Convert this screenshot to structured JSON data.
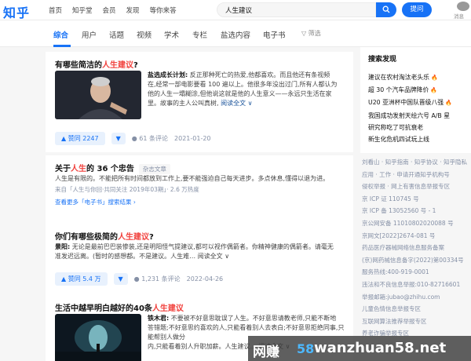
{
  "header": {
    "logo": "知乎",
    "nav": [
      "首页",
      "知乎堂",
      "会员",
      "发现",
      "等你来答"
    ],
    "search_value": "人生建议",
    "ask_label": "提问",
    "avatar_caption": "消息"
  },
  "tabs": {
    "items": [
      "综合",
      "用户",
      "话题",
      "视频",
      "学术",
      "专栏",
      "盐选内容",
      "电子书"
    ],
    "filter": "筛选"
  },
  "results": [
    {
      "title_pre": "有哪些简洁的",
      "title_hl": "人生建议",
      "title_post": "?",
      "author": "盐选成长计划:",
      "lines": [
        "反正那种死亡的热爱,他都喜欢。而且他还有条视频",
        "在,经常一部电影要看 100 遍以上。他很多年没出过门,所有人都认为",
        "他的人生一塌糊涂,但他说这就是他的人生意义——永远只生活在家",
        "里。故事的主人公叫真树,"
      ],
      "read_more": "阅读全文 ∨",
      "vote": "▲ 赞同 2247",
      "down": "▼",
      "comments": "● 61 条评论",
      "date": "2021-01-20"
    },
    {
      "title_pre": "关于",
      "title_hl": "人生",
      "title_post": "的 36 个忠告",
      "tag": "杂志文章",
      "lines": [
        "人生是有限的。不能把所有时间都放到工作上,要不能强迫自己每天进步。多点休息,懂得以退为进。"
      ],
      "source": "来自「人生与你回·共同关注 2019年03期」· 2.6 万热度",
      "ebook_link": "查看更多「电子书」搜索结果 ›"
    },
    {
      "title_pre": "你们有哪些极简的",
      "title_hl": "人生建议",
      "title_post": "?",
      "author": "景阳:",
      "lines": [
        "无论是最前巴巴装惨装,还是明阳怪气提建议,都可以视作偶箭者。你精神健康的偶箭者。请毫无",
        "准发迟远离。(暂时的感想都。不是建议。人生难… 阅读全文 ∨"
      ],
      "vote": "▲ 赞同 5.4 万",
      "down": "▼",
      "comments": "● 1,231 条评论",
      "date": "2022-04-26"
    },
    {
      "title_pre": "生活中越早明白越好的40条",
      "title_hl": "人生建议",
      "title_post": "",
      "author": "铁木君:",
      "lines": [
        "不要被不好意思耽误了人生。不好意思请教老师,只能不断地",
        "答错题;不好意思约喜欢的人,只能看着别人去表白;不好意思拒绝同事,只能帮别人做分",
        "内,只能看着别人升职加薪。人生建议… 阅读全文 ∨"
      ]
    }
  ],
  "sidebar": {
    "title": "搜索发现",
    "hot": [
      "建议在农村淘汰老头乐",
      "超 30 个汽车品牌降价",
      "U20 亚洲杯中国队晋级八强",
      "我国成功发射天绘六号 A/B 星",
      "研究称吃了可抗衰老",
      "新生化危机四试玩上线"
    ],
    "hot_flags": [
      true,
      true,
      true,
      false,
      false,
      false
    ],
    "footer": [
      "刘看山 · 知乎指南 · 知乎协议 · 知乎隐私",
      "应用 · 工作 · 申请开通知乎机构号",
      "侵权举报 · 网上有害信息举报专区",
      "京 ICP 证 110745 号",
      "京 ICP 备 13052560 号 - 1",
      "京公网安备 11010802020088 号",
      "京网文[2022]2674-081 号",
      "药品医疗器械网络信息服务备案",
      "(京)网药械信息备字(2022)第00334号",
      "服务热线:400-919-0001",
      "违法和不良信息举报:010-82716601",
      "举报邮箱:jubao@zhihu.com",
      "儿童色情信息举报专区",
      "互联网算法推荐举报专区",
      "养老诈骗举报专区"
    ]
  },
  "watermark": {
    "cn": "网赚",
    "num": "58",
    "domain": "wanzhuan58.net"
  }
}
